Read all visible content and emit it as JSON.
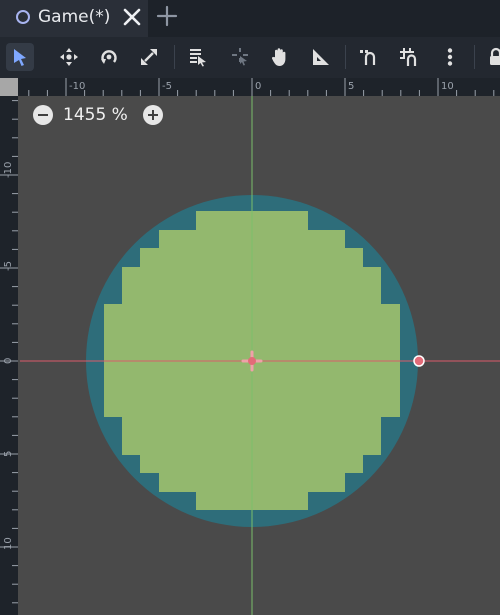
{
  "tab": {
    "title": "Game(*)",
    "icon": "scene-circle-icon",
    "close_icon": "close-icon",
    "add_icon": "plus-icon"
  },
  "toolbar": {
    "tools": [
      {
        "name": "select-tool",
        "icon": "arrow-pointer-icon",
        "active": true
      },
      {
        "name": "move-tool",
        "icon": "move-arrows-icon"
      },
      {
        "name": "rotate-tool",
        "icon": "rotate-icon"
      },
      {
        "name": "scale-tool",
        "icon": "scale-arrows-icon"
      },
      {
        "name": "list-select-tool",
        "icon": "list-pointer-icon"
      },
      {
        "name": "pivot-tool",
        "icon": "pivot-cursor-icon"
      },
      {
        "name": "pan-tool",
        "icon": "hand-icon"
      },
      {
        "name": "ruler-tool",
        "icon": "ruler-icon"
      },
      {
        "name": "smart-snap-toggle",
        "icon": "smart-snap-icon"
      },
      {
        "name": "grid-snap-toggle",
        "icon": "grid-snap-icon"
      },
      {
        "name": "snap-options-menu",
        "icon": "vertical-dots-icon"
      },
      {
        "name": "lock-button",
        "icon": "lock-icon"
      }
    ]
  },
  "viewport": {
    "zoom_level": "1455 %",
    "zoom_out_icon": "minus-circle-icon",
    "zoom_in_icon": "plus-circle-icon",
    "ruler": {
      "horizontal_ticks": [
        "-10",
        "-5",
        "0",
        "5",
        "10"
      ],
      "vertical_ticks": [
        "-10",
        "-5",
        "0",
        "5",
        "10"
      ]
    },
    "colors": {
      "background": "#4a4a4a",
      "ruler": "#1e232a",
      "circle_shape": "#2e6d7a",
      "tile_fill": "#93b86e",
      "x_axis": "#d95b6b",
      "y_axis": "#7bbf6a",
      "handle": "#e36b78"
    }
  }
}
